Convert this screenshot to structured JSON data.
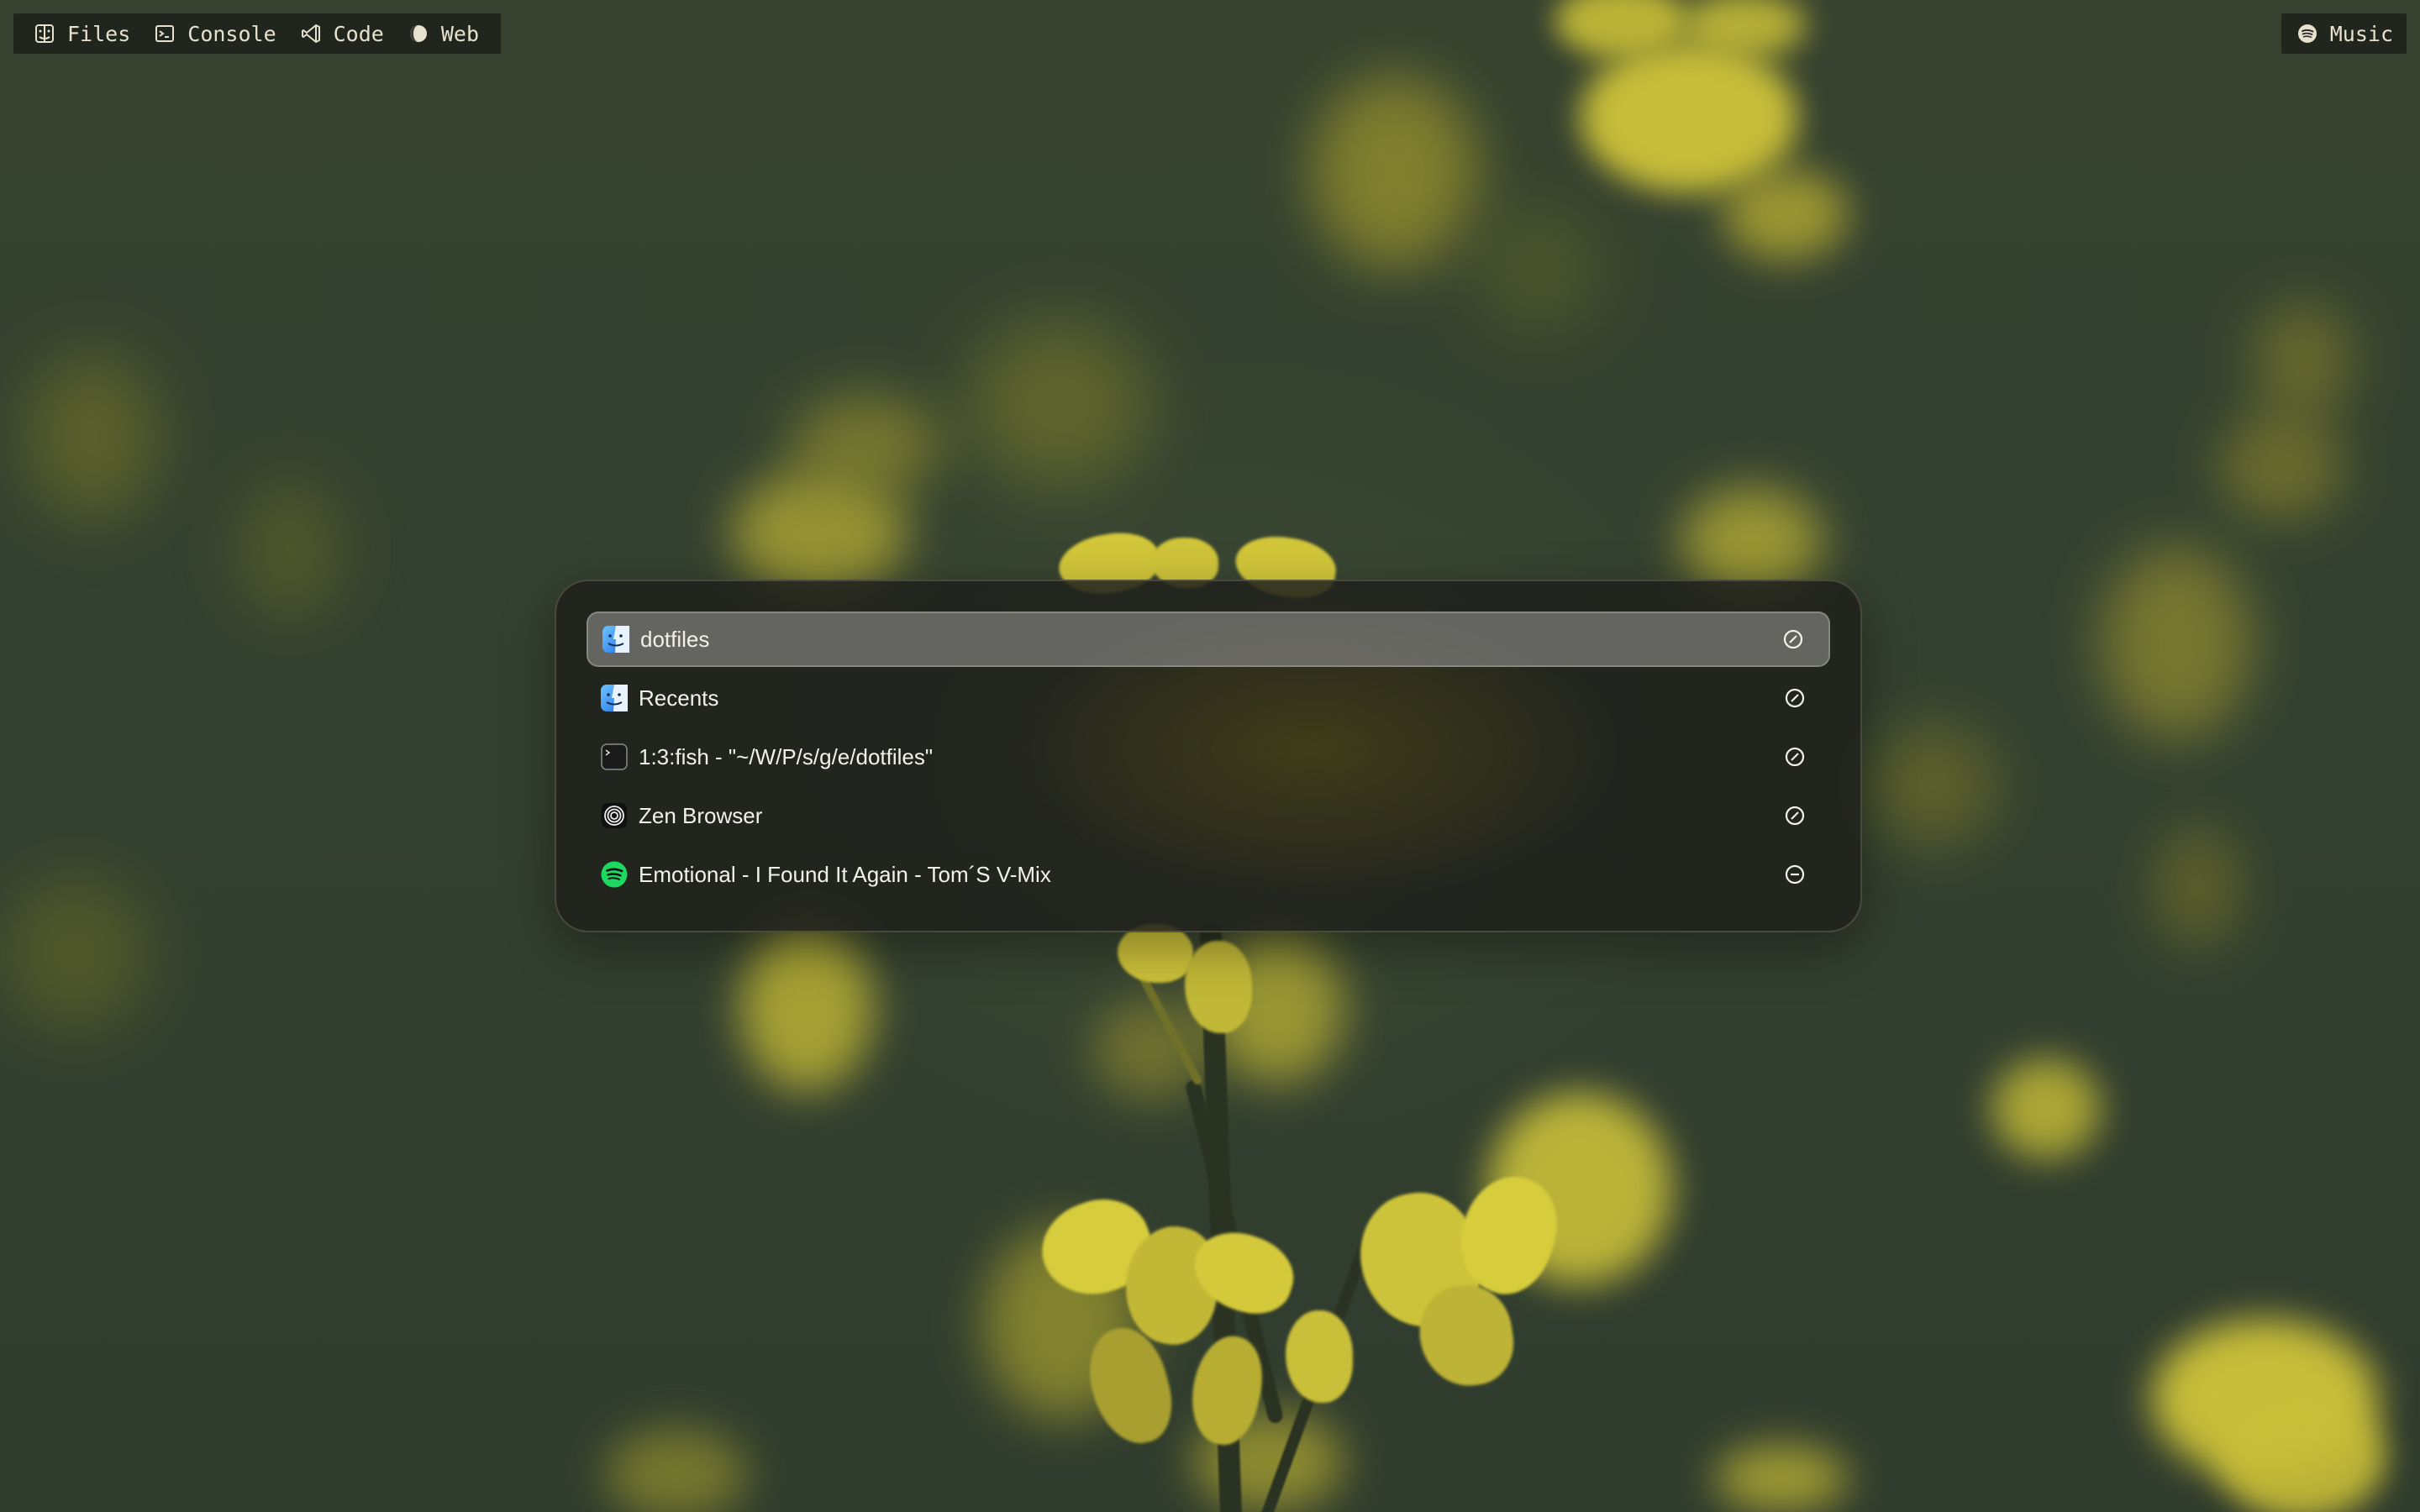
{
  "top_bar": {
    "workspaces": [
      {
        "label": "Files",
        "icon": "finder-icon"
      },
      {
        "label": "Console",
        "icon": "terminal-icon"
      },
      {
        "label": "Code",
        "icon": "vscode-icon"
      },
      {
        "label": "Web",
        "icon": "browser-icon"
      }
    ],
    "right": {
      "label": "Music",
      "icon": "spotify-icon"
    }
  },
  "launcher": {
    "results": [
      {
        "label": "dotfiles",
        "icon": "finder-icon",
        "action_icon": "slashed-circle-icon",
        "selected": true
      },
      {
        "label": "Recents",
        "icon": "finder-icon",
        "action_icon": "slashed-circle-icon",
        "selected": false
      },
      {
        "label": "1:3:fish - \"~/W/P/s/g/e/dotfiles\"",
        "icon": "terminal-icon",
        "action_icon": "slashed-circle-icon",
        "selected": false
      },
      {
        "label": "Zen Browser",
        "icon": "zen-browser-icon",
        "action_icon": "slashed-circle-icon",
        "selected": false
      },
      {
        "label": "Emotional - I Found It Again - Tom´S V-Mix",
        "icon": "spotify-icon",
        "action_icon": "minus-circle-icon",
        "selected": false
      }
    ]
  },
  "colors": {
    "bar_text": "#e7e1cf",
    "selection": "#8c8c8a",
    "spotify_green": "#1ed760",
    "wallpaper_yellow": "#d6cc3a"
  }
}
